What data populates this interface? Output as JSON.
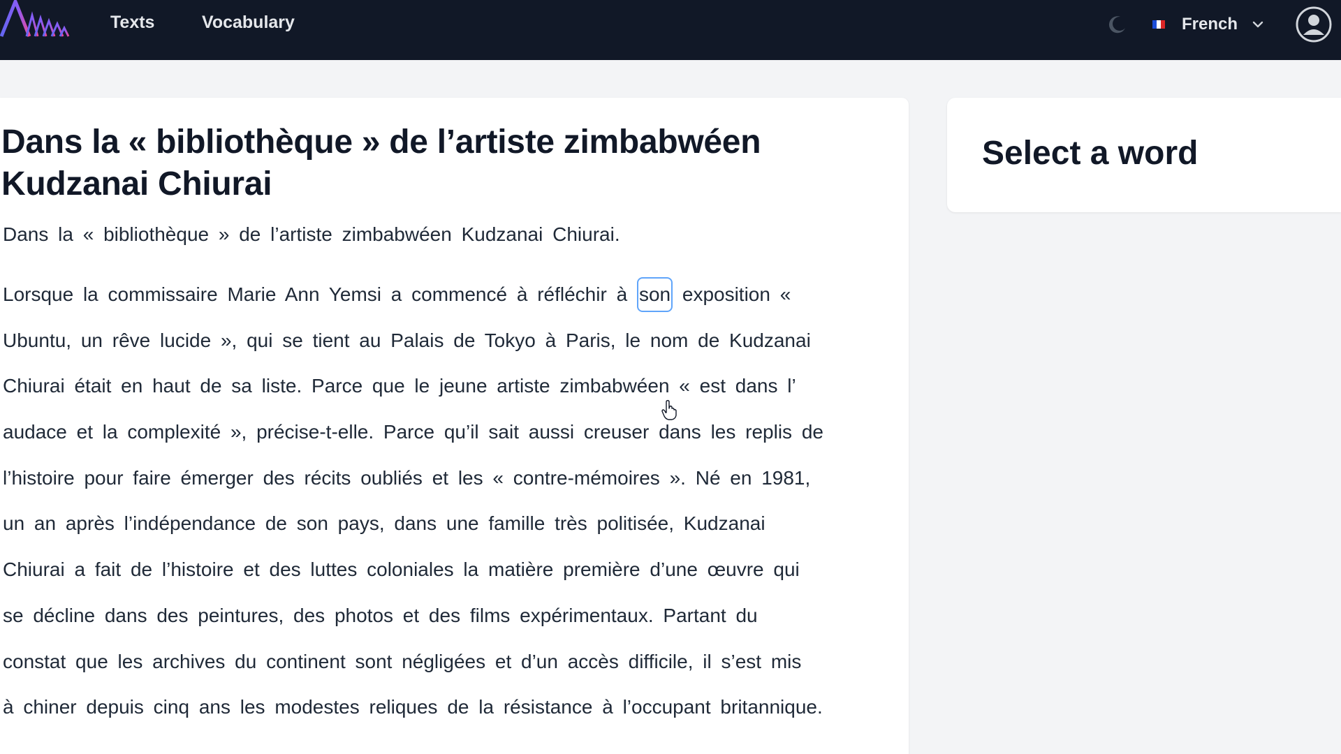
{
  "header": {
    "logo_icon": "app-logo-icon",
    "nav": [
      {
        "label": "Texts"
      },
      {
        "label": "Vocabulary"
      }
    ],
    "theme_icon": "moon-icon",
    "language": {
      "selected": "French",
      "flag_icon": "france-flag-icon",
      "chevron_icon": "chevron-down-icon"
    },
    "account_icon": "user-avatar-icon"
  },
  "article": {
    "title": "Dans la « bibliothèque » de l’artiste zimbabwéen Kudzanai Chiurai",
    "subtitle": "Dans la « bibliothèque » de l’artiste zimbabwéen Kudzanai Chiurai.",
    "selected_word": "son",
    "lines": {
      "l1_before": "Lorsque la commissaire Marie Ann Yemsi a commencé à réfléchir à ",
      "l1_after": " exposition «",
      "l2": "Ubuntu, un rêve lucide », qui se tient au Palais de Tokyo à Paris, le nom de Kudzanai",
      "l3": "Chiurai était en haut de sa liste. Parce que le jeune artiste zimbabwéen « est dans l’",
      "l4": "audace et la complexité », précise-t-elle. Parce qu’il sait aussi creuser dans les replis de",
      "l5": "l’histoire pour faire émerger des récits oubliés et les « contre-mémoires ». Né en 1981,",
      "l6": "un an après l’indépendance de son pays, dans une famille très politisée, Kudzanai",
      "l7": "Chiurai a fait de l’histoire et des luttes coloniales la matière première d’une œuvre qui",
      "l8": "se décline dans des peintures, des photos et des films expérimentaux. Partant du",
      "l9": "constat que les archives du continent sont négligées et d’un accès difficile, il s’est mis",
      "l10": "à chiner depuis cinq ans les modestes reliques de la résistance à l’occupant britannique."
    }
  },
  "side_panel": {
    "heading": "Select a word"
  },
  "colors": {
    "topbar": "#111827",
    "highlight_border": "#60a5fa",
    "page_bg": "#f3f4f6"
  }
}
